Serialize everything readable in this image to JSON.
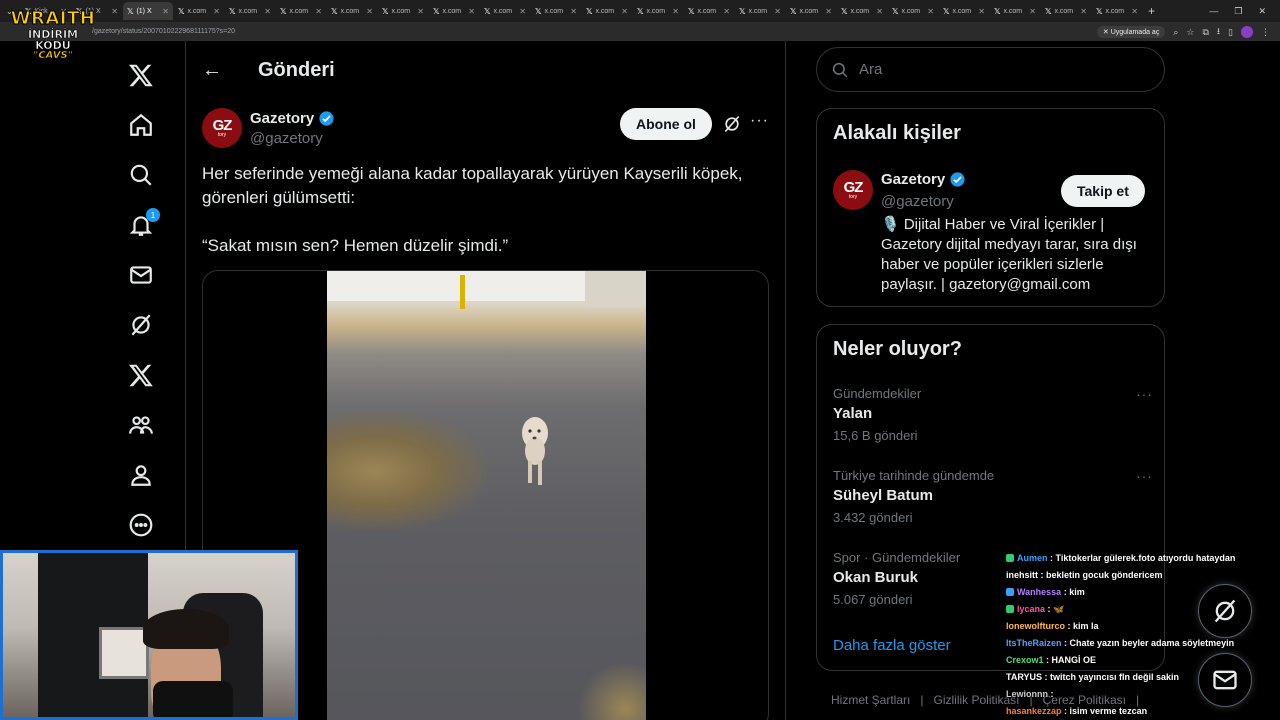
{
  "browser": {
    "tabs": [
      {
        "label": "Kick",
        "active": false
      },
      {
        "label": "(1) X",
        "active": false
      },
      {
        "label": "(1) X",
        "active": true
      },
      {
        "label": "x.com",
        "active": false
      },
      {
        "label": "x.com",
        "active": false
      },
      {
        "label": "x.com",
        "active": false
      },
      {
        "label": "x.com",
        "active": false
      },
      {
        "label": "x.com",
        "active": false
      },
      {
        "label": "x.com",
        "active": false
      },
      {
        "label": "x.com",
        "active": false
      },
      {
        "label": "x.com",
        "active": false
      },
      {
        "label": "x.com",
        "active": false
      },
      {
        "label": "x.com",
        "active": false
      },
      {
        "label": "x.com",
        "active": false
      },
      {
        "label": "x.com",
        "active": false
      },
      {
        "label": "x.com",
        "active": false
      },
      {
        "label": "x.com",
        "active": false
      },
      {
        "label": "x.com",
        "active": false
      },
      {
        "label": "x.com",
        "active": false
      },
      {
        "label": "x.com",
        "active": false
      },
      {
        "label": "x.com",
        "active": false
      },
      {
        "label": "x.com",
        "active": false
      }
    ],
    "url": "/gazetory/status/2007010222968111175?s=20",
    "open_in_app": "Uygulamada aç"
  },
  "overlay": {
    "brand": "WRAITH",
    "line2": "İNDİRİM KODU",
    "line3": "\"CAVS\""
  },
  "nav": {
    "notification_count": "1",
    "items": [
      "x-logo",
      "home",
      "explore",
      "notifications",
      "messages",
      "grok",
      "premium",
      "communities",
      "profile",
      "more"
    ]
  },
  "header": {
    "title": "Gönderi"
  },
  "post": {
    "author_name": "Gazetory",
    "author_handle": "@gazetory",
    "avatar_text": "GZ",
    "avatar_sub": "tory",
    "follow_label": "Abone ol",
    "text_line1": "Her seferinde yemeği alana kadar topallayarak yürüyen Kayserili köpek, görenleri gülümsetti:",
    "text_line2": "“Sakat mısın sen? Hemen düzelir şimdi.”"
  },
  "search": {
    "placeholder": "Ara"
  },
  "related": {
    "title": "Alakalı kişiler",
    "name": "Gazetory",
    "handle": "@gazetory",
    "follow_label": "Takip et",
    "bio": "🎙️ Dijital Haber ve Viral İçerikler | Gazetory dijital medyayı tarar, sıra dışı haber ve popüler içerikleri sizlerle paylaşır. | gazetory@gmail.com"
  },
  "trends": {
    "title": "Neler oluyor?",
    "items": [
      {
        "category": "Gündemdekiler",
        "name": "Yalan",
        "count": "15,6 B gönderi"
      },
      {
        "category": "Türkiye tarihinde gündemde",
        "name": "Süheyl Batum",
        "count": "3.432 gönderi"
      },
      {
        "category": "Spor · Gündemdekiler",
        "name": "Okan Buruk",
        "count": "5.067 gönderi"
      }
    ],
    "show_more": "Daha fazla göster"
  },
  "footer": {
    "links": [
      "Hizmet Şartları",
      "Gizlilik Politikası",
      "Çerez Politikası"
    ]
  },
  "chat": [
    {
      "user": "Aumen",
      "color": "#3aa0ff",
      "msg": "Tiktokerlar gülerek.foto atıyordu hataydan",
      "badge": "#2ecc71"
    },
    {
      "user": "inehsitt",
      "color": "#ffffff",
      "msg": "bekletin gocuk göndericem",
      "badge": ""
    },
    {
      "user": "Wanhessa",
      "color": "#b57cff",
      "msg": "kim",
      "badge": "#3aa0ff"
    },
    {
      "user": "lycana",
      "color": "#ff4fa3",
      "msg": "🦋",
      "badge": "#2ecc71"
    },
    {
      "user": "lonewolfturco",
      "color": "#ffb84f",
      "msg": "kim la",
      "badge": ""
    },
    {
      "user": "ItsTheRaizen",
      "color": "#4fa3ff",
      "msg": "Chate yazın beyler adama söyletmeyin",
      "badge": ""
    },
    {
      "user": "Crexow1",
      "color": "#4fdc7a",
      "msg": "HANGİ OE",
      "badge": ""
    },
    {
      "user": "TARYUS",
      "color": "#ffffff",
      "msg": "twitch yayıncısı fln değil sakin",
      "badge": ""
    },
    {
      "user": "Lewionnn",
      "color": "#cccccc",
      "msg": "",
      "badge": ""
    },
    {
      "user": "hasankezzap",
      "color": "#ff7a3a",
      "msg": "isim verme tezcan",
      "badge": ""
    }
  ],
  "colors": {
    "accent": "#1d9bf0",
    "background": "#000000",
    "border": "#2f3336",
    "muted": "#71767b",
    "webcam_border": "#1f6fd1"
  }
}
